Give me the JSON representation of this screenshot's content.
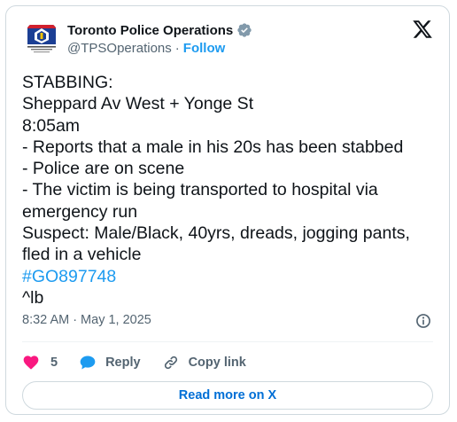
{
  "account": {
    "display_name": "Toronto Police Operations",
    "handle": "@TPSOperations",
    "separator": "·",
    "follow_label": "Follow",
    "avatar_logo_text": "TORONTO POLICE OPERATIONS CENTRE"
  },
  "tweet": {
    "lines": [
      "STABBING:",
      "Sheppard Av West + Yonge St",
      "8:05am",
      "- Reports that a male in his 20s has been stabbed",
      "- Police are on scene",
      "- The victim is being transported to hospital via",
      "emergency run",
      "Suspect: Male/Black, 40yrs, dreads, jogging pants,",
      "fled in a vehicle"
    ],
    "hashtag": "#GO897748",
    "signoff": "^lb"
  },
  "meta": {
    "time": "8:32 AM",
    "separator": "·",
    "date": "May 1, 2025"
  },
  "actions": {
    "like_count": "5",
    "reply_label": "Reply",
    "copy_link_label": "Copy link"
  },
  "read_more_label": "Read more on X",
  "icons": {
    "verified": "verified-badge-icon",
    "platform": "x-logo-icon",
    "info": "info-icon",
    "like": "heart-icon",
    "reply": "speech-bubble-icon",
    "copy": "link-icon"
  },
  "colors": {
    "accent": "#1d9bf0",
    "like": "#f91880",
    "text": "#0f1419",
    "muted": "#536471",
    "link_button": "#006fd6"
  }
}
